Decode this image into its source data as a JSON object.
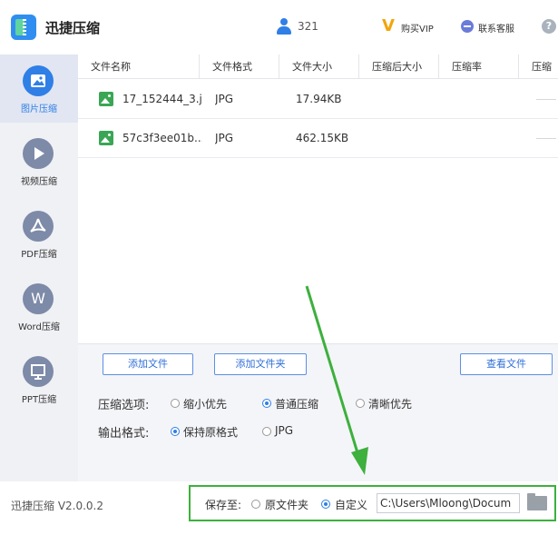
{
  "app": {
    "title": "迅捷压缩",
    "user_count": "321",
    "vip_label": "购买VIP",
    "service_label": "联系客服",
    "help_glyph": "?"
  },
  "sidebar": {
    "items": [
      {
        "label": "图片压缩",
        "icon": "image-icon",
        "active": true
      },
      {
        "label": "视频压缩",
        "icon": "play-icon",
        "active": false
      },
      {
        "label": "PDF压缩",
        "icon": "pdf-icon",
        "active": false
      },
      {
        "label": "Word压缩",
        "icon": "word-icon",
        "glyph": "W",
        "active": false
      },
      {
        "label": "PPT压缩",
        "icon": "ppt-icon",
        "active": false
      }
    ]
  },
  "table": {
    "columns": [
      "文件名称",
      "文件格式",
      "文件大小",
      "压缩后大小",
      "压缩率",
      "压缩"
    ],
    "rows": [
      {
        "name": "17_152444_3.j...",
        "format": "JPG",
        "size": "17.94KB"
      },
      {
        "name": "57c3f3ee01b...",
        "format": "JPG",
        "size": "462.15KB"
      }
    ]
  },
  "controls": {
    "add_file": "添加文件",
    "add_folder": "添加文件夹",
    "view_file": "查看文件",
    "compress_option_label": "压缩选项:",
    "compress_options": [
      "缩小优先",
      "普通压缩",
      "清晰优先"
    ],
    "compress_selected": "普通压缩",
    "output_format_label": "输出格式:",
    "output_options": [
      "保持原格式",
      "JPG"
    ],
    "output_selected": "保持原格式"
  },
  "footer": {
    "version": "迅捷压缩 V2.0.0.2",
    "save_label": "保存至:",
    "save_options": [
      "原文件夹",
      "自定义"
    ],
    "save_selected": "自定义",
    "path_value": "C:\\Users\\Mloong\\Docum"
  },
  "colors": {
    "accent": "#2f7fe6",
    "highlight_green": "#3db03d"
  }
}
